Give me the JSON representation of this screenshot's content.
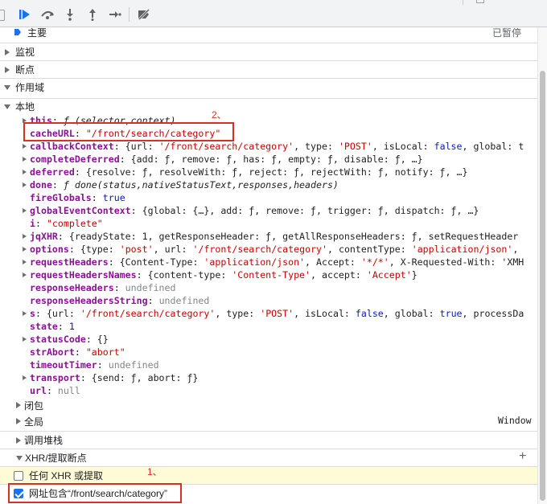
{
  "toolbar": {
    "buttons": [
      "resume-icon",
      "step-over-icon",
      "step-into-icon",
      "step-out-icon",
      "step-icon",
      "deactivate-breakpoints-icon"
    ],
    "accent": "#1a73e8"
  },
  "threads": {
    "main_label": "主要",
    "main_status": "已暂停"
  },
  "sections": {
    "watch": "监视",
    "breakpoints": "断点",
    "scope": "作用域",
    "local": "本地",
    "closure": "闭包",
    "global": "全局",
    "global_value": "Window",
    "call_stack": "调用堆栈",
    "xhr_breakpoints": "XHR/提取断点"
  },
  "scope_props": [
    {
      "key": "this",
      "sep": ": ",
      "value": "ƒ (selector,context)"
    },
    {
      "key": "cacheURL",
      "sep": ": ",
      "value": "\"/front/search/category\""
    },
    {
      "key": "callbackContext",
      "sep": ": ",
      "value": "{url: '/front/search/category', type: 'POST', isLocal: false, global: t"
    },
    {
      "key": "completeDeferred",
      "sep": ": ",
      "value": "{add: ƒ, remove: ƒ, has: ƒ, empty: ƒ, disable: ƒ, …}"
    },
    {
      "key": "deferred",
      "sep": ": ",
      "value": "{resolve: ƒ, resolveWith: ƒ, reject: ƒ, rejectWith: ƒ, notify: ƒ, …}"
    },
    {
      "key": "done",
      "sep": ": ",
      "value": "ƒ done(status,nativeStatusText,responses,headers)"
    },
    {
      "key": "fireGlobals",
      "sep": ": ",
      "value": "true"
    },
    {
      "key": "globalEventContext",
      "sep": ": ",
      "value": "{global: {…}, add: ƒ, remove: ƒ, trigger: ƒ, dispatch: ƒ, …}"
    },
    {
      "key": "i",
      "sep": ": ",
      "value": "\"complete\""
    },
    {
      "key": "jqXHR",
      "sep": ": ",
      "value": "{readyState: 1, getResponseHeader: ƒ, getAllResponseHeaders: ƒ, setRequestHeader"
    },
    {
      "key": "options",
      "sep": ": ",
      "value": "{type: 'post', url: '/front/search/category', contentType: 'application/json',"
    },
    {
      "key": "requestHeaders",
      "sep": ": ",
      "value": "{Content-Type: 'application/json', Accept: '*/*', X-Requested-With: 'XMH"
    },
    {
      "key": "requestHeadersNames",
      "sep": ": ",
      "value": "{content-type: 'Content-Type', accept: 'Accept'}"
    },
    {
      "key": "responseHeaders",
      "sep": ": ",
      "value": "undefined"
    },
    {
      "key": "responseHeadersString",
      "sep": ": ",
      "value": "undefined"
    },
    {
      "key": "s",
      "sep": ": ",
      "value": "{url: '/front/search/category', type: 'POST', isLocal: false, global: true, processDa"
    },
    {
      "key": "state",
      "sep": ": ",
      "value": "1"
    },
    {
      "key": "statusCode",
      "sep": ": ",
      "value": "{}"
    },
    {
      "key": "strAbort",
      "sep": ": ",
      "value": "\"abort\""
    },
    {
      "key": "timeoutTimer",
      "sep": ": ",
      "value": "undefined"
    },
    {
      "key": "transport",
      "sep": ": ",
      "value": "{send: ƒ, abort: ƒ}"
    },
    {
      "key": "url",
      "sep": ": ",
      "value": "null"
    }
  ],
  "xhr": {
    "any_label": "任何 XHR 或提取",
    "url_contains_label": "网址包含“/front/search/category”"
  },
  "annotations": {
    "one": "1、",
    "two": "2、"
  }
}
